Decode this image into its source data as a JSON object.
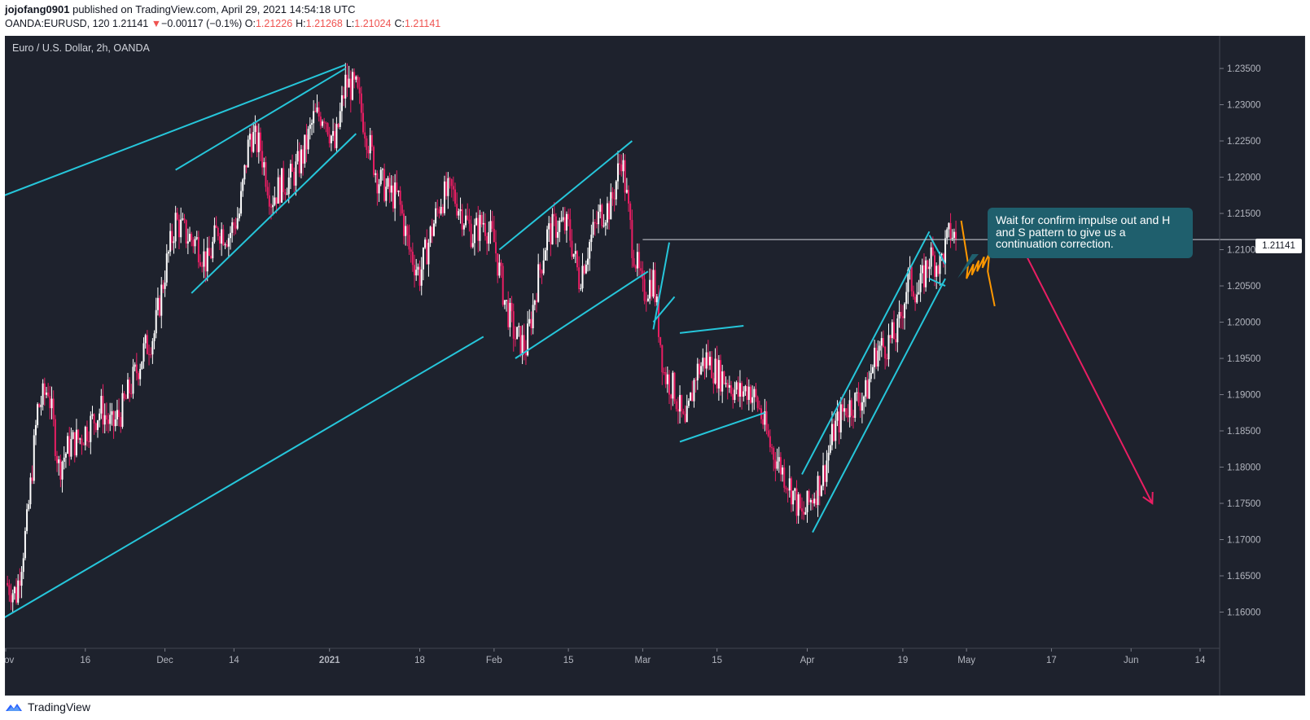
{
  "header": {
    "author": "jojofang0901",
    "published_text": "published on TradingView.com, April 29, 2021 14:54:18 UTC",
    "symbol": "OANDA:EURUSD, 120",
    "last": "1.21141",
    "change_arrow": "▼",
    "change": "−0.00117 (−0.1%)",
    "o_label": "O:",
    "o_value": "1.21226",
    "h_label": "H:",
    "h_value": "1.21268",
    "l_label": "L:",
    "l_value": "1.21024",
    "c_label": "C:",
    "c_value": "1.21141"
  },
  "chart_title": "Euro / U.S. Dollar, 2h, OANDA",
  "callout_text": "Wait for confirm impulse out and H and S pattern to give us a continuation correction.",
  "price_badge": "1.21141",
  "footer": {
    "brand": "TradingView",
    "icon": "tradingview-logo-icon"
  },
  "colors": {
    "background": "#1e222d",
    "up_candle": "#ffffff",
    "down_candle": "#e91e63",
    "trendline": "#26c6da",
    "projection": "#ff9800",
    "arrow": "#e91e63",
    "callout": "#1f5f6d",
    "axis_text": "#b2b5be"
  },
  "chart_data": {
    "type": "line",
    "title": "Euro / U.S. Dollar, 2h, OANDA",
    "xlabel": "",
    "ylabel": "",
    "ylim": [
      1.155,
      1.2395
    ],
    "y_ticks": [
      "1.16000",
      "1.16500",
      "1.17000",
      "1.17500",
      "1.18000",
      "1.18500",
      "1.19000",
      "1.19500",
      "1.20000",
      "1.20500",
      "1.21000",
      "1.21500",
      "1.22000",
      "1.22500",
      "1.23000",
      "1.23500"
    ],
    "x_ticks": [
      {
        "label": "Nov",
        "day": 0
      },
      {
        "label": "16",
        "day": 15
      },
      {
        "label": "Dec",
        "day": 30
      },
      {
        "label": "14",
        "day": 43
      },
      {
        "label": "2021",
        "day": 61
      },
      {
        "label": "18",
        "day": 78
      },
      {
        "label": "Feb",
        "day": 92
      },
      {
        "label": "15",
        "day": 106
      },
      {
        "label": "Mar",
        "day": 120
      },
      {
        "label": "15",
        "day": 134
      },
      {
        "label": "Apr",
        "day": 151
      },
      {
        "label": "19",
        "day": 169
      },
      {
        "label": "May",
        "day": 181
      },
      {
        "label": "17",
        "day": 197
      },
      {
        "label": "Jun",
        "day": 212
      },
      {
        "label": "14",
        "day": 225
      }
    ],
    "series": [
      {
        "values": [
          {
            "x": "2020-11-01",
            "y": 1.164
          },
          {
            "x": "2020-11-03",
            "y": 1.1625
          },
          {
            "x": "2020-11-05",
            "y": 1.172
          },
          {
            "x": "2020-11-07",
            "y": 1.188
          },
          {
            "x": "2020-11-09",
            "y": 1.191
          },
          {
            "x": "2020-11-11",
            "y": 1.18
          },
          {
            "x": "2020-11-13",
            "y": 1.183
          },
          {
            "x": "2020-11-15",
            "y": 1.184
          },
          {
            "x": "2020-11-17",
            "y": 1.186
          },
          {
            "x": "2020-11-19",
            "y": 1.188
          },
          {
            "x": "2020-11-21",
            "y": 1.1855
          },
          {
            "x": "2020-11-23",
            "y": 1.188
          },
          {
            "x": "2020-11-25",
            "y": 1.192
          },
          {
            "x": "2020-11-27",
            "y": 1.196
          },
          {
            "x": "2020-11-29",
            "y": 1.1985
          },
          {
            "x": "2020-12-01",
            "y": 1.207
          },
          {
            "x": "2020-12-03",
            "y": 1.214
          },
          {
            "x": "2020-12-05",
            "y": 1.212
          },
          {
            "x": "2020-12-07",
            "y": 1.211
          },
          {
            "x": "2020-12-09",
            "y": 1.208
          },
          {
            "x": "2020-12-11",
            "y": 1.213
          },
          {
            "x": "2020-12-13",
            "y": 1.212
          },
          {
            "x": "2020-12-15",
            "y": 1.215
          },
          {
            "x": "2020-12-17",
            "y": 1.226
          },
          {
            "x": "2020-12-19",
            "y": 1.224
          },
          {
            "x": "2020-12-21",
            "y": 1.217
          },
          {
            "x": "2020-12-23",
            "y": 1.219
          },
          {
            "x": "2020-12-25",
            "y": 1.22
          },
          {
            "x": "2020-12-27",
            "y": 1.223
          },
          {
            "x": "2020-12-29",
            "y": 1.228
          },
          {
            "x": "2020-12-31",
            "y": 1.229
          },
          {
            "x": "2021-01-02",
            "y": 1.224
          },
          {
            "x": "2021-01-04",
            "y": 1.233
          },
          {
            "x": "2021-01-06",
            "y": 1.232
          },
          {
            "x": "2021-01-08",
            "y": 1.226
          },
          {
            "x": "2021-01-10",
            "y": 1.22
          },
          {
            "x": "2021-01-12",
            "y": 1.218
          },
          {
            "x": "2021-01-14",
            "y": 1.217
          },
          {
            "x": "2021-01-16",
            "y": 1.21
          },
          {
            "x": "2021-01-18",
            "y": 1.2065
          },
          {
            "x": "2021-01-20",
            "y": 1.212
          },
          {
            "x": "2021-01-22",
            "y": 1.217
          },
          {
            "x": "2021-01-24",
            "y": 1.218
          },
          {
            "x": "2021-01-26",
            "y": 1.215
          },
          {
            "x": "2021-01-28",
            "y": 1.212
          },
          {
            "x": "2021-01-30",
            "y": 1.214
          },
          {
            "x": "2021-02-01",
            "y": 1.211
          },
          {
            "x": "2021-02-03",
            "y": 1.203
          },
          {
            "x": "2021-02-05",
            "y": 1.198
          },
          {
            "x": "2021-02-07",
            "y": 1.1965
          },
          {
            "x": "2021-02-09",
            "y": 1.205
          },
          {
            "x": "2021-02-11",
            "y": 1.212
          },
          {
            "x": "2021-02-13",
            "y": 1.2135
          },
          {
            "x": "2021-02-15",
            "y": 1.213
          },
          {
            "x": "2021-02-17",
            "y": 1.206
          },
          {
            "x": "2021-02-19",
            "y": 1.211
          },
          {
            "x": "2021-02-21",
            "y": 1.215
          },
          {
            "x": "2021-02-23",
            "y": 1.216
          },
          {
            "x": "2021-02-25",
            "y": 1.223
          },
          {
            "x": "2021-02-27",
            "y": 1.211
          },
          {
            "x": "2021-03-01",
            "y": 1.204
          },
          {
            "x": "2021-03-03",
            "y": 1.206
          },
          {
            "x": "2021-03-05",
            "y": 1.193
          },
          {
            "x": "2021-03-07",
            "y": 1.1905
          },
          {
            "x": "2021-03-09",
            "y": 1.185
          },
          {
            "x": "2021-03-11",
            "y": 1.193
          },
          {
            "x": "2021-03-13",
            "y": 1.195
          },
          {
            "x": "2021-03-15",
            "y": 1.193
          },
          {
            "x": "2021-03-17",
            "y": 1.192
          },
          {
            "x": "2021-03-19",
            "y": 1.19
          },
          {
            "x": "2021-03-21",
            "y": 1.191
          },
          {
            "x": "2021-03-23",
            "y": 1.188
          },
          {
            "x": "2021-03-25",
            "y": 1.183
          },
          {
            "x": "2021-03-27",
            "y": 1.18
          },
          {
            "x": "2021-03-29",
            "y": 1.177
          },
          {
            "x": "2021-03-31",
            "y": 1.173
          },
          {
            "x": "2021-04-02",
            "y": 1.176
          },
          {
            "x": "2021-04-04",
            "y": 1.179
          },
          {
            "x": "2021-04-06",
            "y": 1.185
          },
          {
            "x": "2021-04-08",
            "y": 1.188
          },
          {
            "x": "2021-04-10",
            "y": 1.189
          },
          {
            "x": "2021-04-12",
            "y": 1.19
          },
          {
            "x": "2021-04-14",
            "y": 1.196
          },
          {
            "x": "2021-04-16",
            "y": 1.197
          },
          {
            "x": "2021-04-18",
            "y": 1.1985
          },
          {
            "x": "2021-04-20",
            "y": 1.206
          },
          {
            "x": "2021-04-22",
            "y": 1.204
          },
          {
            "x": "2021-04-24",
            "y": 1.209
          },
          {
            "x": "2021-04-26",
            "y": 1.208
          },
          {
            "x": "2021-04-28",
            "y": 1.2125
          },
          {
            "x": "2021-04-29",
            "y": 1.2114
          }
        ]
      }
    ],
    "current_price": 1.21141,
    "annotations": [
      {
        "type": "trendline",
        "from": {
          "x": "2020-10-30",
          "y": 1.217
        },
        "to": {
          "x": "2021-01-04",
          "y": 1.2355
        }
      },
      {
        "type": "trendline",
        "from": {
          "x": "2020-12-03",
          "y": 1.221
        },
        "to": {
          "x": "2021-01-04",
          "y": 1.235
        }
      },
      {
        "type": "trendline",
        "from": {
          "x": "2020-12-06",
          "y": 1.204
        },
        "to": {
          "x": "2021-01-06",
          "y": 1.226
        }
      },
      {
        "type": "trendline",
        "from": {
          "x": "2020-10-30",
          "y": 1.1585
        },
        "to": {
          "x": "2021-01-30",
          "y": 1.198
        }
      },
      {
        "type": "trendline",
        "from": {
          "x": "2021-02-02",
          "y": 1.21
        },
        "to": {
          "x": "2021-02-27",
          "y": 1.225
        }
      },
      {
        "type": "trendline",
        "from": {
          "x": "2021-02-05",
          "y": 1.195
        },
        "to": {
          "x": "2021-03-02",
          "y": 1.207
        }
      },
      {
        "type": "trendline",
        "from": {
          "x": "2021-03-03",
          "y": 1.199
        },
        "to": {
          "x": "2021-03-06",
          "y": 1.211
        }
      },
      {
        "type": "trendline",
        "from": {
          "x": "2021-03-03",
          "y": 1.2
        },
        "to": {
          "x": "2021-03-07",
          "y": 1.2035
        }
      },
      {
        "type": "trendline",
        "from": {
          "x": "2021-03-08",
          "y": 1.1985
        },
        "to": {
          "x": "2021-03-20",
          "y": 1.1995
        }
      },
      {
        "type": "trendline",
        "from": {
          "x": "2021-03-08",
          "y": 1.1835
        },
        "to": {
          "x": "2021-03-24",
          "y": 1.1875
        }
      },
      {
        "type": "trendline",
        "from": {
          "x": "2021-03-31",
          "y": 1.179
        },
        "to": {
          "x": "2021-04-24",
          "y": 1.2125
        }
      },
      {
        "type": "trendline",
        "from": {
          "x": "2021-04-02",
          "y": 1.171
        },
        "to": {
          "x": "2021-04-27",
          "y": 1.206
        }
      },
      {
        "type": "trendline",
        "from": {
          "x": "2021-04-24",
          "y": 1.212
        },
        "to": {
          "x": "2021-04-27",
          "y": 1.208
        }
      },
      {
        "type": "trendline",
        "from": {
          "x": "2021-04-24",
          "y": 1.206
        },
        "to": {
          "x": "2021-04-27",
          "y": 1.205
        }
      },
      {
        "type": "horizontal",
        "from": {
          "x": "2021-03-01",
          "y": 1.2114
        },
        "to": {
          "x": "2021-06-26",
          "y": 1.2114
        }
      },
      {
        "type": "projection",
        "points": [
          {
            "x": "2021-04-30",
            "y": 1.214
          },
          {
            "x": "2021-05-01",
            "y": 1.208
          },
          {
            "x": "2021-05-01",
            "y": 1.206
          },
          {
            "x": "2021-05-02",
            "y": 1.208
          },
          {
            "x": "2021-05-02",
            "y": 1.2065
          },
          {
            "x": "2021-05-03",
            "y": 1.2085
          },
          {
            "x": "2021-05-03",
            "y": 1.207
          },
          {
            "x": "2021-05-04",
            "y": 1.209
          },
          {
            "x": "2021-05-04",
            "y": 1.2075
          },
          {
            "x": "2021-05-05",
            "y": 1.2095
          },
          {
            "x": "2021-05-05",
            "y": 1.207
          },
          {
            "x": "2021-05-06",
            "y": 1.2022
          }
        ]
      },
      {
        "type": "arrow",
        "from": {
          "x": "2021-05-11",
          "y": 1.211
        },
        "to": {
          "x": "2021-06-05",
          "y": 1.175
        }
      }
    ]
  }
}
